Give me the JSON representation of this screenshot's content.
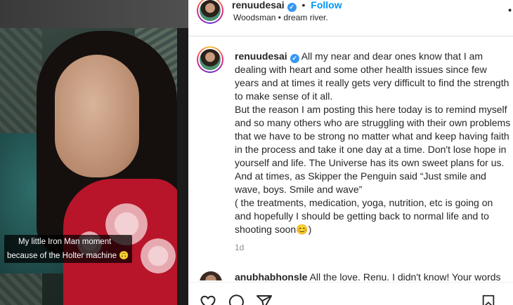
{
  "media": {
    "caption_line1": "My little Iron Man moment",
    "caption_line2": "because of the Holter machine 🙃"
  },
  "header": {
    "username": "renuudesai",
    "separator": "•",
    "follow_label": "Follow",
    "location": "Woodsman • dream river.",
    "more_icon": "⋮"
  },
  "post": {
    "username": "renuudesai",
    "paragraphs": [
      "All my near and dear ones know that I am dealing with heart and some other health issues since few years and at times it really gets very difficult to find the strength to make sense of it all.",
      "But the reason I am posting this here today is to remind myself and so many others who are struggling with their own problems that we have to be strong no matter what and keep having faith in the process and take it one day at a time. Don't lose hope in yourself and life. The Universe has its own sweet plans for us. And at times, as Skipper the Penguin said “Just smile and wave, boys. Smile and wave”",
      "( the treatments, medication, yoga, nutrition, etc is going on and hopefully I should be getting back to normal life and to shooting soon😊)"
    ],
    "time_ago": "1d"
  },
  "comment": {
    "username": "anubhabhonsle",
    "text": "All the love, Renu. I didn't know! Your words"
  },
  "icons": {
    "verified": "check-verified-icon",
    "like": "heart-icon",
    "comment": "comment-icon",
    "share": "share-icon",
    "save": "bookmark-icon"
  },
  "colors": {
    "accent": "#0095f6",
    "verified": "#3897f0"
  }
}
